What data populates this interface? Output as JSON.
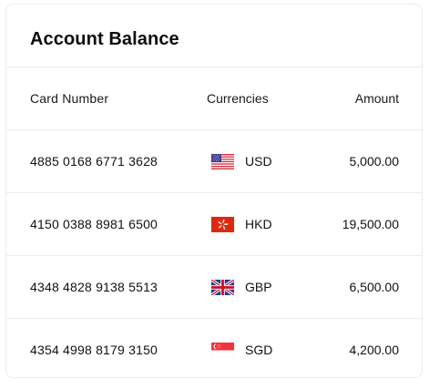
{
  "title": "Account Balance",
  "columns": {
    "card_number": "Card Number",
    "currencies": "Currencies",
    "amount": "Amount"
  },
  "rows": [
    {
      "card_number": "4885 0168 6771 3628",
      "currency": "USD",
      "flag_icon": "us-flag-icon",
      "amount": "5,000.00"
    },
    {
      "card_number": "4150 0388 8981 6500",
      "currency": "HKD",
      "flag_icon": "hk-flag-icon",
      "amount": "19,500.00"
    },
    {
      "card_number": "4348 4828 9138 5513",
      "currency": "GBP",
      "flag_icon": "gb-flag-icon",
      "amount": "6,500.00"
    },
    {
      "card_number": "4354 4998 8179 3150",
      "currency": "SGD",
      "flag_icon": "sg-flag-icon",
      "amount": "4,200.00"
    }
  ],
  "colors": {
    "border": "#ececec",
    "text": "#111111"
  }
}
